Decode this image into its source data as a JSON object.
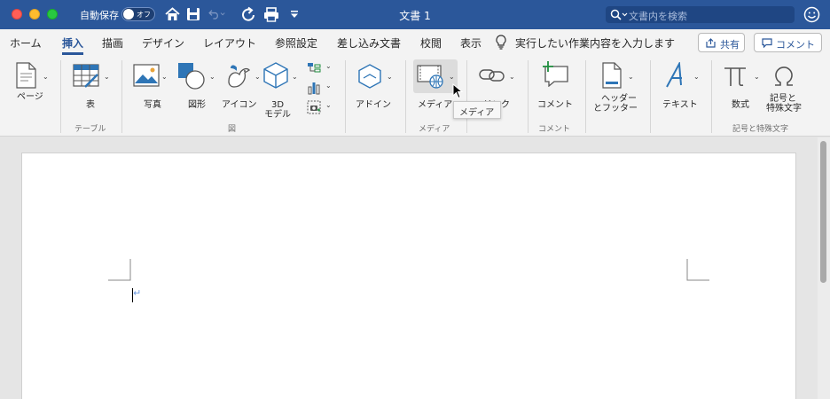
{
  "titlebar": {
    "autosave_label": "自動保存",
    "autosave_state": "オフ",
    "doc_title": "文書 1",
    "search_placeholder": "文書内を検索",
    "icons": [
      "home-icon",
      "save-icon",
      "undo-icon",
      "redo-icon",
      "print-icon",
      "customize-toolbar-icon",
      "smiley-feedback-icon"
    ]
  },
  "tabs": [
    "ホーム",
    "挿入",
    "描画",
    "デザイン",
    "レイアウト",
    "参照設定",
    "差し込み文書",
    "校閲",
    "表示"
  ],
  "active_tab": "挿入",
  "tell_me": "実行したい作業内容を入力します",
  "share_label": "共有",
  "comment_label": "コメント",
  "ribbon": {
    "page": "ページ",
    "table": "表",
    "group_table": "テーブル",
    "picture": "写真",
    "shapes": "図形",
    "icons": "アイコン",
    "model3d_line1": "3D",
    "model3d_line2": "モデル",
    "group_illustrations": "図",
    "addins": "アドイン",
    "media": "メディア",
    "group_media": "メディア",
    "link": "リンク",
    "comment": "コメント",
    "group_comment": "コメント",
    "header_footer_line1": "ヘッダー",
    "header_footer_line2": "とフッター",
    "text": "テキスト",
    "equation": "数式",
    "symbol_line1": "記号と",
    "symbol_line2": "特殊文字",
    "group_symbols": "記号と特殊文字"
  },
  "tooltip": "メディア",
  "colors": {
    "brand": "#2b579a",
    "accent_green": "#1e8e3e",
    "icon_blue": "#2e75b6"
  }
}
